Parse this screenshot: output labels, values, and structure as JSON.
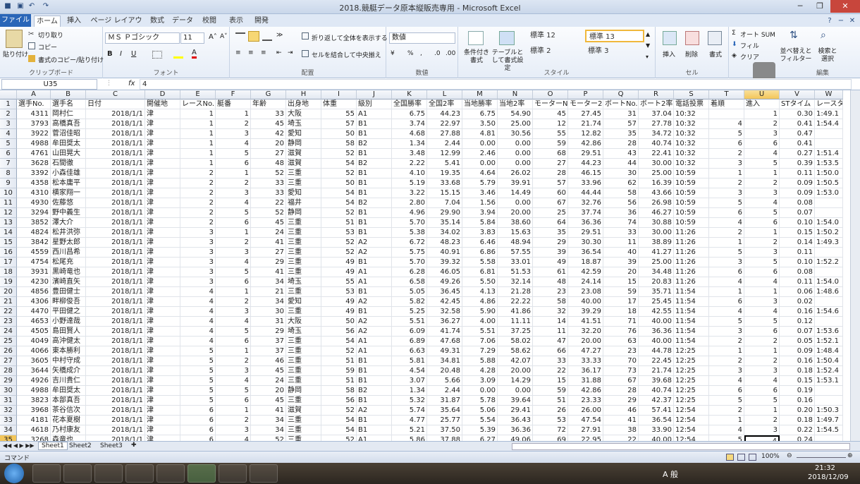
{
  "window": {
    "title": "2018.競艇データ原本縦販売専用 - Microsoft Excel"
  },
  "ribbon_tabs": [
    "ファイル",
    "ホーム",
    "挿入",
    "ページ レイアウト",
    "数式",
    "データ",
    "校閲",
    "表示",
    "開発"
  ],
  "clipboard": {
    "paste": "貼り付け",
    "cut": "切り取り",
    "copy": "コピー",
    "format_painter": "書式のコピー/貼り付け",
    "label": "クリップボード"
  },
  "font": {
    "name": "ＭＳ Ｐゴシック",
    "size": "11",
    "label": "フォント"
  },
  "alignment": {
    "wrap": "折り返して全体を表示する",
    "merge": "セルを結合して中央揃え",
    "label": "配置"
  },
  "number": {
    "format": "数値",
    "label": "数値"
  },
  "styles": {
    "conditional": "条件付き書式",
    "table": "テーブルとして書式設定",
    "cells": [
      "標準 12",
      "標準 13",
      "標準 2",
      "標準 3"
    ],
    "label": "スタイル"
  },
  "cells_group": {
    "insert": "挿入",
    "delete": "削除",
    "format": "書式",
    "label": "セル"
  },
  "editing": {
    "autosum": "オート SUM",
    "fill": "フィル",
    "clear": "クリア",
    "sort": "並べ替えと フィルター",
    "find": "検索と 選択",
    "label": "編集"
  },
  "formula_bar": {
    "name_box": "U35",
    "fx": "fx",
    "value": "4"
  },
  "columns": [
    "A",
    "B",
    "C",
    "D",
    "E",
    "F",
    "G",
    "H",
    "I",
    "J",
    "K",
    "L",
    "M",
    "N",
    "O",
    "P",
    "Q",
    "R",
    "S",
    "T",
    "U",
    "V",
    "W"
  ],
  "headers": [
    "選手No.",
    "選手名",
    "日付",
    "開催地",
    "レースNo.",
    "艇番",
    "年齢",
    "出身地",
    "体重",
    "級別",
    "全国勝率",
    "全国2率",
    "当地勝率",
    "当地2率",
    "モーターNo.",
    "モーター2率",
    "ボートNo.",
    "ボート2率",
    "電話投票",
    "着順",
    "進入",
    "STタイム",
    "レースタ"
  ],
  "rows": [
    [
      "4311",
      "岡村仁",
      "2018/1/1",
      "津",
      "1",
      "1",
      "33",
      "大阪",
      "55",
      "A1",
      "6.75",
      "44.23",
      "6.75",
      "54.90",
      "45",
      "27.45",
      "31",
      "37.04",
      "10:32",
      "",
      "1",
      "0.30",
      "1:49.1"
    ],
    [
      "3793",
      "高橋真吾",
      "2018/1/1",
      "津",
      "1",
      "2",
      "45",
      "埼玉",
      "57",
      "B1",
      "3.74",
      "22.97",
      "3.50",
      "25.00",
      "12",
      "21.74",
      "57",
      "27.78",
      "10:32",
      "4",
      "2",
      "0.41",
      "1:54.4"
    ],
    [
      "3922",
      "菅沼佳昭",
      "2018/1/1",
      "津",
      "1",
      "3",
      "42",
      "愛知",
      "50",
      "B1",
      "4.68",
      "27.88",
      "4.81",
      "30.56",
      "55",
      "12.82",
      "35",
      "34.72",
      "10:32",
      "5",
      "3",
      "0.47",
      ""
    ],
    [
      "4988",
      "牟田奨太",
      "2018/1/1",
      "津",
      "1",
      "4",
      "20",
      "静岡",
      "58",
      "B2",
      "1.34",
      "2.44",
      "0.00",
      "0.00",
      "59",
      "42.86",
      "28",
      "40.74",
      "10:32",
      "6",
      "6",
      "0.41",
      ""
    ],
    [
      "4761",
      "山田晃大",
      "2018/1/1",
      "津",
      "1",
      "5",
      "27",
      "滋賀",
      "52",
      "B1",
      "3.48",
      "12.99",
      "2.46",
      "0.00",
      "68",
      "29.51",
      "43",
      "22.41",
      "10:32",
      "2",
      "4",
      "0.27",
      "1:51.4"
    ],
    [
      "3628",
      "石間徹",
      "2018/1/1",
      "津",
      "1",
      "6",
      "48",
      "滋賀",
      "54",
      "B2",
      "2.22",
      "5.41",
      "0.00",
      "0.00",
      "27",
      "44.23",
      "44",
      "30.00",
      "10:32",
      "3",
      "5",
      "0.39",
      "1:53.5"
    ],
    [
      "3392",
      "小森佳雄",
      "2018/1/1",
      "津",
      "2",
      "1",
      "52",
      "三重",
      "52",
      "B1",
      "4.10",
      "19.35",
      "4.64",
      "26.02",
      "28",
      "46.15",
      "30",
      "25.00",
      "10:59",
      "1",
      "1",
      "0.11",
      "1:50.0"
    ],
    [
      "4358",
      "松本庸平",
      "2018/1/1",
      "津",
      "2",
      "2",
      "33",
      "三重",
      "50",
      "B1",
      "5.19",
      "33.68",
      "5.79",
      "39.91",
      "57",
      "33.96",
      "62",
      "16.39",
      "10:59",
      "2",
      "2",
      "0.09",
      "1:50.5"
    ],
    [
      "4310",
      "横家翔一",
      "2018/1/1",
      "津",
      "2",
      "3",
      "33",
      "愛知",
      "54",
      "B1",
      "3.22",
      "15.15",
      "3.46",
      "14.49",
      "60",
      "44.44",
      "58",
      "43.66",
      "10:59",
      "3",
      "3",
      "0.09",
      "1:53.0"
    ],
    [
      "4930",
      "佐藤悠",
      "2018/1/1",
      "津",
      "2",
      "4",
      "22",
      "福井",
      "54",
      "B2",
      "2.80",
      "7.04",
      "1.56",
      "0.00",
      "67",
      "32.76",
      "56",
      "26.98",
      "10:59",
      "5",
      "4",
      "0.08",
      ""
    ],
    [
      "3294",
      "野中義生",
      "2018/1/1",
      "津",
      "2",
      "5",
      "52",
      "静岡",
      "52",
      "B1",
      "4.96",
      "29.90",
      "3.94",
      "20.00",
      "25",
      "37.74",
      "36",
      "46.27",
      "10:59",
      "6",
      "5",
      "0.07",
      ""
    ],
    [
      "3852",
      "澤大介",
      "2018/1/1",
      "津",
      "2",
      "6",
      "45",
      "三重",
      "51",
      "B1",
      "5.70",
      "35.14",
      "5.84",
      "38.60",
      "64",
      "36.36",
      "74",
      "30.88",
      "10:59",
      "4",
      "6",
      "0.10",
      "1:54.0"
    ],
    [
      "4824",
      "松井洪弥",
      "2018/1/1",
      "津",
      "3",
      "1",
      "24",
      "三重",
      "53",
      "B1",
      "5.38",
      "34.02",
      "3.83",
      "15.63",
      "35",
      "29.51",
      "33",
      "30.00",
      "11:26",
      "2",
      "1",
      "0.15",
      "1:50.2"
    ],
    [
      "3842",
      "星野太郎",
      "2018/1/1",
      "津",
      "3",
      "2",
      "41",
      "三重",
      "52",
      "A2",
      "6.72",
      "48.23",
      "6.46",
      "48.94",
      "29",
      "30.30",
      "11",
      "38.89",
      "11:26",
      "1",
      "2",
      "0.14",
      "1:49.3"
    ],
    [
      "4559",
      "西川昌希",
      "2018/1/1",
      "津",
      "3",
      "3",
      "27",
      "三重",
      "52",
      "A2",
      "5.75",
      "40.91",
      "6.86",
      "57.55",
      "39",
      "36.54",
      "40",
      "41.27",
      "11:26",
      "5",
      "3",
      "0.11",
      ""
    ],
    [
      "4754",
      "松尾充",
      "2018/1/1",
      "津",
      "3",
      "4",
      "29",
      "三重",
      "49",
      "B1",
      "5.70",
      "39.32",
      "5.58",
      "33.01",
      "49",
      "18.87",
      "39",
      "25.00",
      "11:26",
      "3",
      "5",
      "0.10",
      "1:52.2"
    ],
    [
      "3931",
      "黒崎竜也",
      "2018/1/1",
      "津",
      "3",
      "5",
      "41",
      "三重",
      "49",
      "A1",
      "6.28",
      "46.05",
      "6.81",
      "51.53",
      "61",
      "42.59",
      "20",
      "34.48",
      "11:26",
      "6",
      "6",
      "0.08",
      ""
    ],
    [
      "4230",
      "濱崎直矢",
      "2018/1/1",
      "津",
      "3",
      "6",
      "34",
      "埼玉",
      "55",
      "A1",
      "6.58",
      "49.26",
      "5.50",
      "32.14",
      "48",
      "24.14",
      "15",
      "20.83",
      "11:26",
      "4",
      "4",
      "0.11",
      "1:54.0"
    ],
    [
      "4856",
      "豊田健士",
      "2018/1/1",
      "津",
      "4",
      "1",
      "21",
      "三重",
      "53",
      "B1",
      "5.05",
      "36.45",
      "4.13",
      "21.28",
      "23",
      "23.08",
      "59",
      "35.71",
      "11:54",
      "1",
      "1",
      "0.06",
      "1:48.6"
    ],
    [
      "4306",
      "畔柳俊吾",
      "2018/1/1",
      "津",
      "4",
      "2",
      "34",
      "愛知",
      "49",
      "A2",
      "5.82",
      "42.45",
      "4.86",
      "22.22",
      "58",
      "40.00",
      "17",
      "25.45",
      "11:54",
      "6",
      "3",
      "0.02",
      ""
    ],
    [
      "4470",
      "平田健之",
      "2018/1/1",
      "津",
      "4",
      "3",
      "30",
      "三重",
      "49",
      "B1",
      "5.25",
      "32.58",
      "5.90",
      "41.86",
      "32",
      "39.29",
      "18",
      "42.55",
      "11:54",
      "4",
      "4",
      "0.16",
      "1:54.6"
    ],
    [
      "4653",
      "小野達哉",
      "2018/1/1",
      "津",
      "4",
      "4",
      "31",
      "大阪",
      "50",
      "A2",
      "5.51",
      "36.27",
      "4.00",
      "11.11",
      "14",
      "41.51",
      "71",
      "40.00",
      "11:54",
      "5",
      "5",
      "0.12",
      ""
    ],
    [
      "4505",
      "島田賢人",
      "2018/1/1",
      "津",
      "4",
      "5",
      "29",
      "埼玉",
      "56",
      "A2",
      "6.09",
      "41.74",
      "5.51",
      "37.25",
      "11",
      "32.20",
      "76",
      "36.36",
      "11:54",
      "3",
      "6",
      "0.07",
      "1:53.6"
    ],
    [
      "4049",
      "高沖健太",
      "2018/1/1",
      "津",
      "4",
      "6",
      "37",
      "三重",
      "54",
      "A1",
      "6.89",
      "47.68",
      "7.06",
      "58.02",
      "47",
      "20.00",
      "63",
      "40.00",
      "11:54",
      "2",
      "2",
      "0.05",
      "1:52.1"
    ],
    [
      "4066",
      "東本勝利",
      "2018/1/1",
      "津",
      "5",
      "1",
      "37",
      "三重",
      "52",
      "A1",
      "6.63",
      "49.31",
      "7.29",
      "58.62",
      "66",
      "47.27",
      "23",
      "44.78",
      "12:25",
      "1",
      "1",
      "0.09",
      "1:48.4"
    ],
    [
      "3605",
      "中村守成",
      "2018/1/1",
      "津",
      "5",
      "2",
      "46",
      "三重",
      "51",
      "B1",
      "5.81",
      "34.81",
      "5.88",
      "42.07",
      "33",
      "33.33",
      "70",
      "22.45",
      "12:25",
      "2",
      "2",
      "0.16",
      "1:50.4"
    ],
    [
      "3644",
      "矢橋成介",
      "2018/1/1",
      "津",
      "5",
      "3",
      "45",
      "三重",
      "59",
      "B1",
      "4.54",
      "20.48",
      "4.28",
      "20.00",
      "22",
      "36.17",
      "73",
      "21.74",
      "12:25",
      "3",
      "3",
      "0.18",
      "1:52.4"
    ],
    [
      "4926",
      "吉川貴仁",
      "2018/1/1",
      "津",
      "5",
      "4",
      "24",
      "三重",
      "51",
      "B1",
      "3.07",
      "5.66",
      "3.09",
      "14.29",
      "15",
      "31.88",
      "67",
      "39.68",
      "12:25",
      "4",
      "4",
      "0.15",
      "1:53.1"
    ],
    [
      "4988",
      "牟田奨太",
      "2018/1/1",
      "津",
      "5",
      "5",
      "20",
      "静岡",
      "58",
      "B2",
      "1.34",
      "2.44",
      "0.00",
      "0.00",
      "59",
      "42.86",
      "28",
      "40.74",
      "12:25",
      "6",
      "6",
      "0.19",
      ""
    ],
    [
      "3823",
      "本部真吾",
      "2018/1/1",
      "津",
      "5",
      "6",
      "45",
      "三重",
      "56",
      "B1",
      "5.32",
      "31.87",
      "5.78",
      "39.64",
      "51",
      "23.33",
      "29",
      "42.37",
      "12:25",
      "5",
      "5",
      "0.16",
      ""
    ],
    [
      "3968",
      "茶谷信次",
      "2018/1/1",
      "津",
      "6",
      "1",
      "41",
      "滋賀",
      "52",
      "A2",
      "5.74",
      "35.64",
      "5.06",
      "29.41",
      "26",
      "26.00",
      "46",
      "57.41",
      "12:54",
      "2",
      "1",
      "0.20",
      "1:50.3"
    ],
    [
      "4181",
      "花本夏樹",
      "2018/1/1",
      "津",
      "6",
      "2",
      "34",
      "三重",
      "54",
      "B1",
      "4.77",
      "25.77",
      "5.54",
      "36.43",
      "53",
      "47.54",
      "41",
      "36.54",
      "12:54",
      "1",
      "2",
      "0.18",
      "1:49.7"
    ],
    [
      "4618",
      "乃村康友",
      "2018/1/1",
      "津",
      "6",
      "3",
      "34",
      "三重",
      "54",
      "B1",
      "5.21",
      "37.50",
      "5.39",
      "36.36",
      "72",
      "27.91",
      "38",
      "33.90",
      "12:54",
      "4",
      "3",
      "0.22",
      "1:54.5"
    ],
    [
      "3268",
      "森竜也",
      "2018/1/1",
      "津",
      "6",
      "4",
      "52",
      "三重",
      "52",
      "A1",
      "5.86",
      "37.88",
      "6.27",
      "49.06",
      "69",
      "22.95",
      "22",
      "40.00",
      "12:54",
      "5",
      "4",
      "0.24",
      ""
    ]
  ],
  "sheets": [
    "Sheet1",
    "Sheet2",
    "Sheet3"
  ],
  "status": {
    "mode": "コマンド",
    "zoom": "100%"
  },
  "taskbar": {
    "ime": "A 般",
    "time": "21:32",
    "date": "2018/12/09"
  }
}
